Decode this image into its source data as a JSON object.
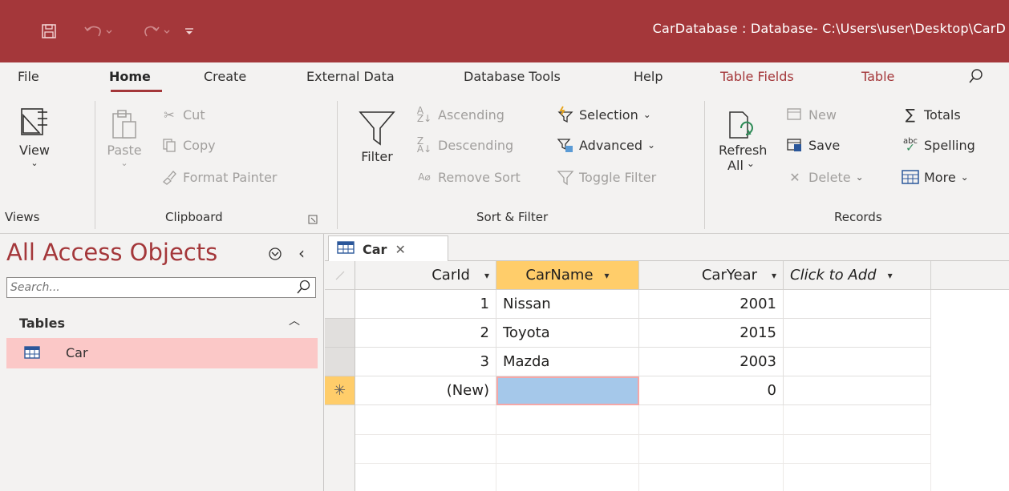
{
  "titlebar": {
    "text": "CarDatabase : Database- C:\\Users\\user\\Desktop\\CarD"
  },
  "tabs": [
    "File",
    "Home",
    "Create",
    "External Data",
    "Database Tools",
    "Help",
    "Table Fields",
    "Table"
  ],
  "ribbon": {
    "views": {
      "view_label": "View",
      "group": "Views"
    },
    "clipboard": {
      "paste": "Paste",
      "cut": "Cut",
      "copy": "Copy",
      "format_painter": "Format Painter",
      "group": "Clipboard"
    },
    "sort_filter": {
      "filter": "Filter",
      "ascending": "Ascending",
      "descending": "Descending",
      "remove_sort": "Remove Sort",
      "selection": "Selection",
      "advanced": "Advanced",
      "toggle_filter": "Toggle Filter",
      "group": "Sort & Filter"
    },
    "records": {
      "refresh_line1": "Refresh",
      "refresh_line2": "All",
      "new": "New",
      "save": "Save",
      "delete": "Delete",
      "totals": "Totals",
      "spelling": "Spelling",
      "more": "More",
      "group": "Records"
    }
  },
  "nav": {
    "title": "All Access Objects",
    "search_placeholder": "Search...",
    "section": "Tables",
    "items": [
      {
        "label": "Car"
      }
    ]
  },
  "document": {
    "tab_label": "Car",
    "columns": [
      {
        "label": "CarId"
      },
      {
        "label": "CarName"
      },
      {
        "label": "CarYear"
      },
      {
        "label": "Click to Add"
      }
    ],
    "rows": [
      {
        "id": "1",
        "name": "Nissan",
        "year": "2001"
      },
      {
        "id": "2",
        "name": "Toyota",
        "year": "2015"
      },
      {
        "id": "3",
        "name": "Mazda",
        "year": "2003"
      }
    ],
    "new_row": {
      "id": "(New)",
      "name": "",
      "year": "0"
    }
  },
  "colors": {
    "accent": "#a4373a",
    "selected_header": "#ffcd6a",
    "selected_nav": "#fbc8c7",
    "active_cell": "#a5c8ea"
  }
}
